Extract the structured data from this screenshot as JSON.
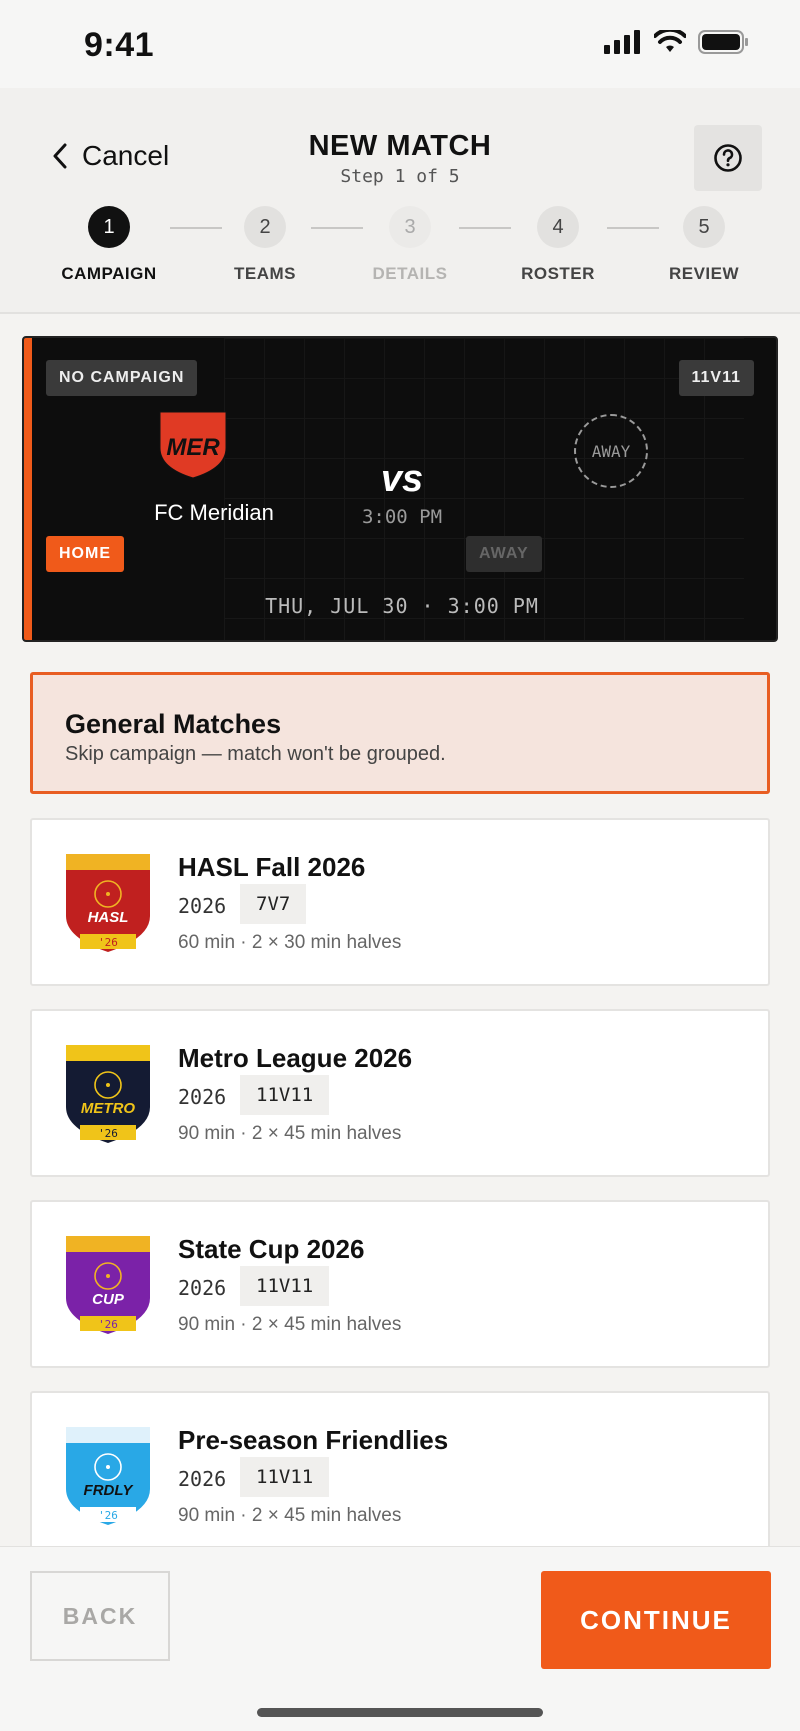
{
  "status_bar": {
    "time": "9:41"
  },
  "header": {
    "cancel_label": "Cancel",
    "title": "NEW MATCH",
    "subtitle": "Step 1 of 5",
    "help_icon": "question-circle-icon"
  },
  "stepper": {
    "steps": [
      {
        "number": "1",
        "label": "CAMPAIGN",
        "state": "active"
      },
      {
        "number": "2",
        "label": "TEAMS",
        "state": "default"
      },
      {
        "number": "3",
        "label": "DETAILS",
        "state": "disabled"
      },
      {
        "number": "4",
        "label": "ROSTER",
        "state": "default"
      },
      {
        "number": "5",
        "label": "REVIEW",
        "state": "default"
      }
    ]
  },
  "match_card": {
    "campaign_chip": "NO CAMPAIGN",
    "format_chip": "11V11",
    "home_team": {
      "name": "FC Meridian",
      "crest_text": "MER"
    },
    "home_chip": "HOME",
    "vs_label": "vs",
    "kickoff": "3:00 PM",
    "away_placeholder": "AWAY",
    "away_chip": "AWAY",
    "date_line": "THU, JUL 30 · 3:00 PM"
  },
  "general_option": {
    "title": "General Matches",
    "subtitle": "Skip campaign — match won't be grouped."
  },
  "campaigns": [
    {
      "name": "HASL Fall 2026",
      "year": "2026",
      "format": "7V7",
      "duration": "60 min · 2 × 30 min halves",
      "crest_text": "HASL",
      "crest_year": "'26",
      "colors": {
        "top": "#f0b323",
        "body": "#c0201f",
        "text": "#ffffff"
      }
    },
    {
      "name": "Metro League 2026",
      "year": "2026",
      "format": "11V11",
      "duration": "90 min · 2 × 45 min halves",
      "crest_text": "METRO",
      "crest_year": "'26",
      "colors": {
        "top": "#f0c419",
        "body": "#141b33",
        "text": "#f0c419"
      }
    },
    {
      "name": "State Cup 2026",
      "year": "2026",
      "format": "11V11",
      "duration": "90 min · 2 × 45 min halves",
      "crest_text": "CUP",
      "crest_year": "'26",
      "colors": {
        "top": "#f0b323",
        "body": "#7b22a8",
        "text": "#ffffff"
      }
    },
    {
      "name": "Pre-season Friendlies",
      "year": "2026",
      "format": "11V11",
      "duration": "90 min · 2 × 45 min halves",
      "crest_text": "FRDLY",
      "crest_year": "'26",
      "colors": {
        "top": "#dff1fb",
        "body": "#29a8e6",
        "text": "#111111"
      }
    }
  ],
  "footer": {
    "back_label": "BACK",
    "continue_label": "CONTINUE"
  },
  "colors": {
    "accent": "#f05a1a",
    "card_bg": "#0d0d0d",
    "general_bg": "#f5e4dd"
  }
}
